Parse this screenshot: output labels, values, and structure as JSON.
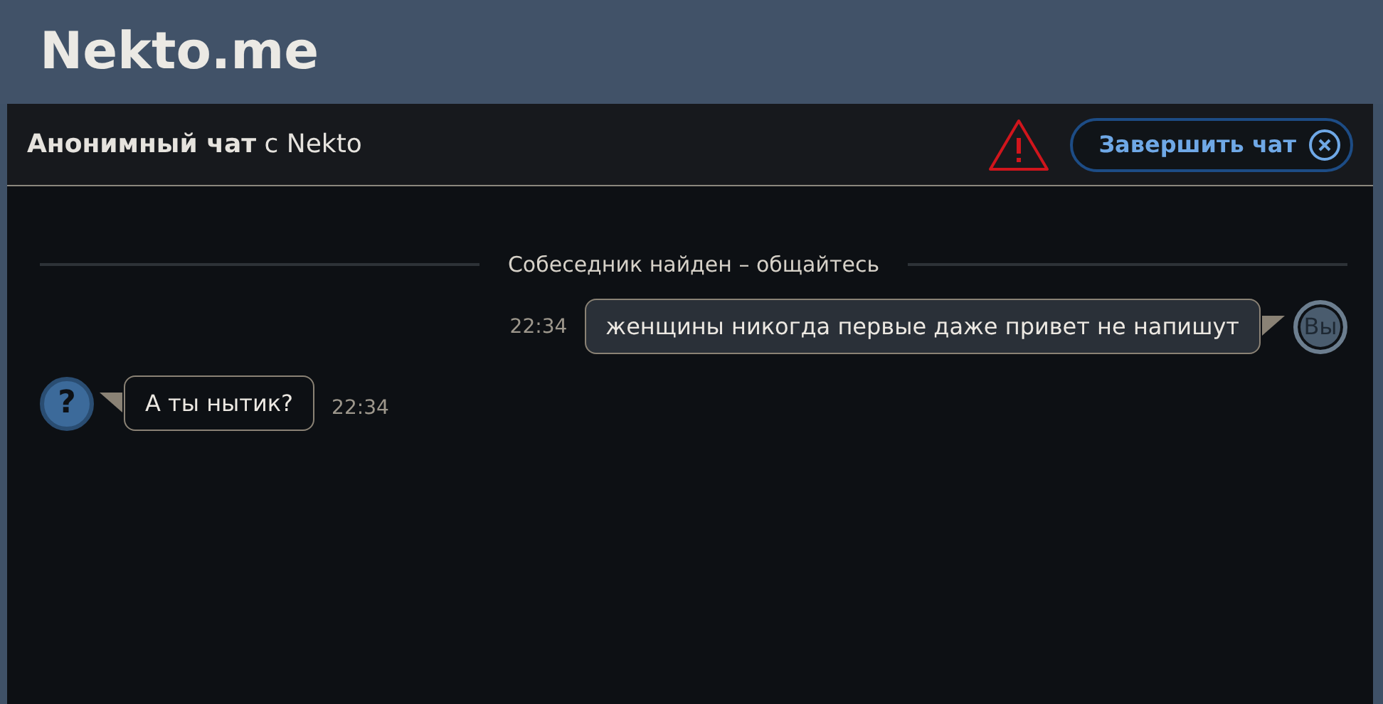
{
  "site": {
    "logo": "Nekto.me"
  },
  "chat_header": {
    "title": "**Анонимный чат** с Nekto",
    "end_button": "Завершить чат"
  },
  "system_message": "Собеседник найден – общайтесь",
  "messages": [
    {
      "kind": "own",
      "text": "женщины никогда первые даже привет не напишут",
      "time": "22:34",
      "avatar": "Вы"
    },
    {
      "kind": "partner",
      "text": "А ты нытик?",
      "time": "22:34",
      "avatar": "?"
    }
  ]
}
